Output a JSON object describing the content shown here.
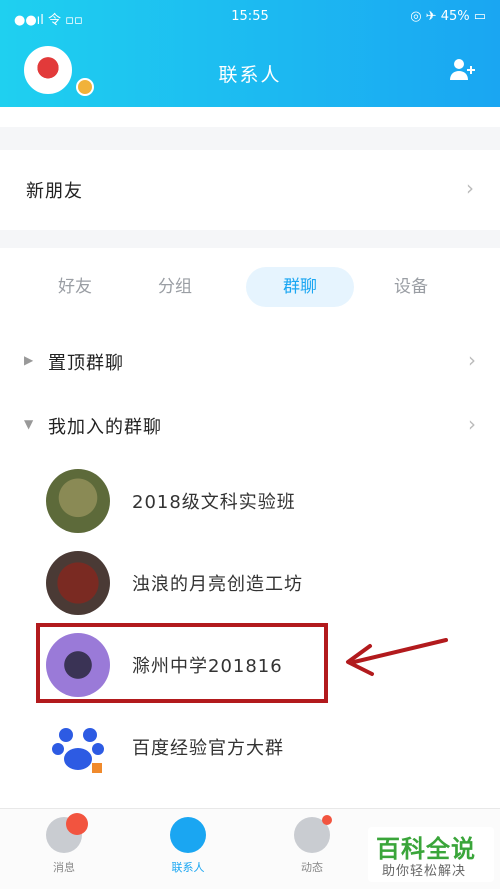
{
  "status": {
    "left": "●●ıl 令 ▫▫ ",
    "time": "15:55",
    "right": "◎ ✈ 45% ▭"
  },
  "header": {
    "title": "联系人"
  },
  "new_friend": {
    "label": "新朋友"
  },
  "tabs": [
    {
      "label": "好友"
    },
    {
      "label": "分组"
    },
    {
      "label": "群聊"
    },
    {
      "label": "设备"
    }
  ],
  "groups": {
    "pinned": {
      "label": "置顶群聊"
    },
    "joined": {
      "label": "我加入的群聊"
    }
  },
  "chats": [
    {
      "name": "2018级文科实验班"
    },
    {
      "name": "浊浪的月亮创造工坊"
    },
    {
      "name": "滁州中学201816"
    },
    {
      "name": "百度经验官方大群"
    }
  ],
  "bottom_tabs": [
    {
      "label": "消息"
    },
    {
      "label": "联系人"
    },
    {
      "label": "动态"
    }
  ],
  "watermark": {
    "title": "百科全说",
    "subtitle": "助你轻松解决"
  },
  "colors": {
    "accent": "#1aa6f2",
    "highlight": "#b21a1d",
    "badge": "#f2543f"
  }
}
